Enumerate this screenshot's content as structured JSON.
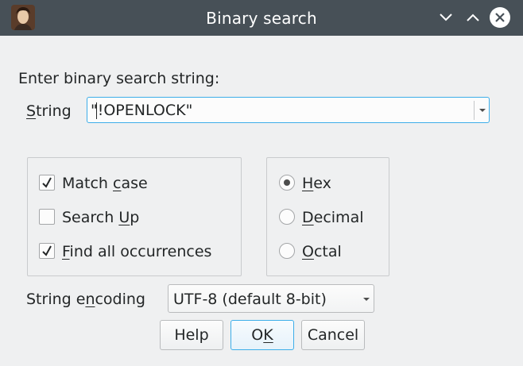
{
  "window": {
    "title": "Binary search",
    "colors": {
      "titlebar": "#475057",
      "accent": "#3daee9",
      "background": "#eff0f1"
    }
  },
  "prompt": "Enter binary search string:",
  "string_field": {
    "label_prefix": "S",
    "label_rest": "tring",
    "value": "\"!OPENLOCK\""
  },
  "options": {
    "match_case": {
      "before": "Match ",
      "mnemonic": "c",
      "after": "ase",
      "checked": true
    },
    "search_up": {
      "before": "Search ",
      "mnemonic": "U",
      "after": "p",
      "checked": false
    },
    "find_all": {
      "before": "",
      "mnemonic": "F",
      "after": "ind all occurrences",
      "checked": true
    }
  },
  "radix": {
    "hex": {
      "mnemonic": "H",
      "rest": "ex",
      "selected": true
    },
    "decimal": {
      "mnemonic": "D",
      "rest": "ecimal",
      "selected": false
    },
    "octal": {
      "mnemonic": "O",
      "rest": "ctal",
      "selected": false
    }
  },
  "encoding": {
    "label_before": "String e",
    "label_mnemonic": "n",
    "label_after": "coding",
    "selected": "UTF-8 (default 8-bit)"
  },
  "buttons": {
    "help": "Help",
    "ok_before": "O",
    "ok_mnemonic": "K",
    "cancel": "Cancel"
  }
}
